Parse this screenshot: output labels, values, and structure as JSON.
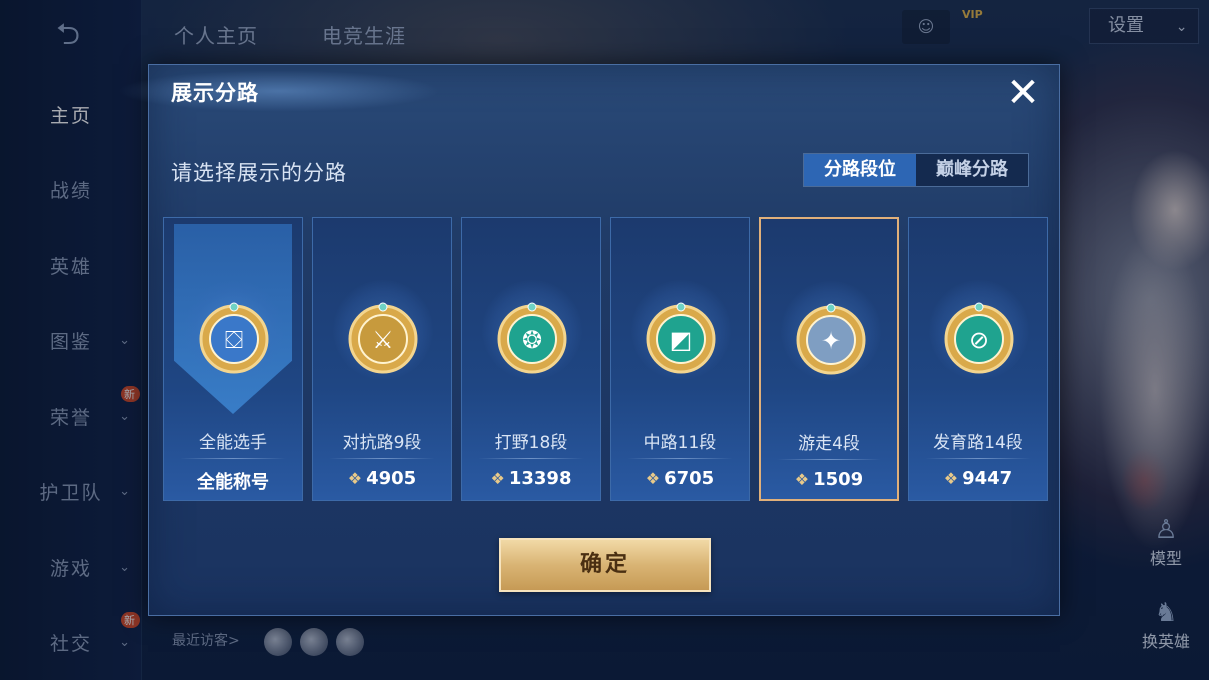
{
  "topbar": {
    "tabs": [
      "个人主页",
      "电竞生涯"
    ],
    "vip_text": "VIP",
    "settings_label": "设置",
    "settings_chevron": "⌄"
  },
  "sidebar": {
    "back_icon": "back-arrow-icon",
    "items": [
      {
        "label": "主页",
        "active": true,
        "chevron": false,
        "badge": ""
      },
      {
        "label": "战绩",
        "active": false,
        "chevron": false,
        "badge": ""
      },
      {
        "label": "英雄",
        "active": false,
        "chevron": false,
        "badge": ""
      },
      {
        "label": "图鉴",
        "active": false,
        "chevron": true,
        "badge": ""
      },
      {
        "label": "荣誉",
        "active": false,
        "chevron": true,
        "badge": "新"
      },
      {
        "label": "护卫队",
        "active": false,
        "chevron": true,
        "badge": ""
      },
      {
        "label": "游戏",
        "active": false,
        "chevron": true,
        "badge": ""
      },
      {
        "label": "社交",
        "active": false,
        "chevron": true,
        "badge": "新"
      }
    ]
  },
  "bottom": {
    "visitors_label": "最近访客>"
  },
  "side_actions": {
    "model_label": "模型",
    "switch_hero_label": "换英雄"
  },
  "modal": {
    "title": "展示分路",
    "close_icon": "close-icon",
    "prompt": "请选择展示的分路",
    "toggle": {
      "options": [
        "分路段位",
        "巅峰分路"
      ],
      "selected": "分路段位"
    },
    "lanes": [
      {
        "label": "全能选手",
        "score": "",
        "sub": "全能称号",
        "medal": "all-round-medal-icon",
        "selected": false,
        "highlighted": true,
        "color": "#3a78c9"
      },
      {
        "label": "对抗路9段",
        "score": "4905",
        "sub": "",
        "medal": "clash-lane-medal-icon",
        "selected": false,
        "highlighted": false,
        "color": "#c79a3d"
      },
      {
        "label": "打野18段",
        "score": "13398",
        "sub": "",
        "medal": "jungle-medal-icon",
        "selected": false,
        "highlighted": false,
        "color": "#1fa38f"
      },
      {
        "label": "中路11段",
        "score": "6705",
        "sub": "",
        "medal": "mid-lane-medal-icon",
        "selected": false,
        "highlighted": false,
        "color": "#1fa38f"
      },
      {
        "label": "游走4段",
        "score": "1509",
        "sub": "",
        "medal": "roam-medal-icon",
        "selected": true,
        "highlighted": false,
        "color": "#7f9ec2"
      },
      {
        "label": "发育路14段",
        "score": "9447",
        "sub": "",
        "medal": "farm-lane-medal-icon",
        "selected": false,
        "highlighted": false,
        "color": "#1fa38f"
      }
    ],
    "confirm_label": "确定"
  }
}
